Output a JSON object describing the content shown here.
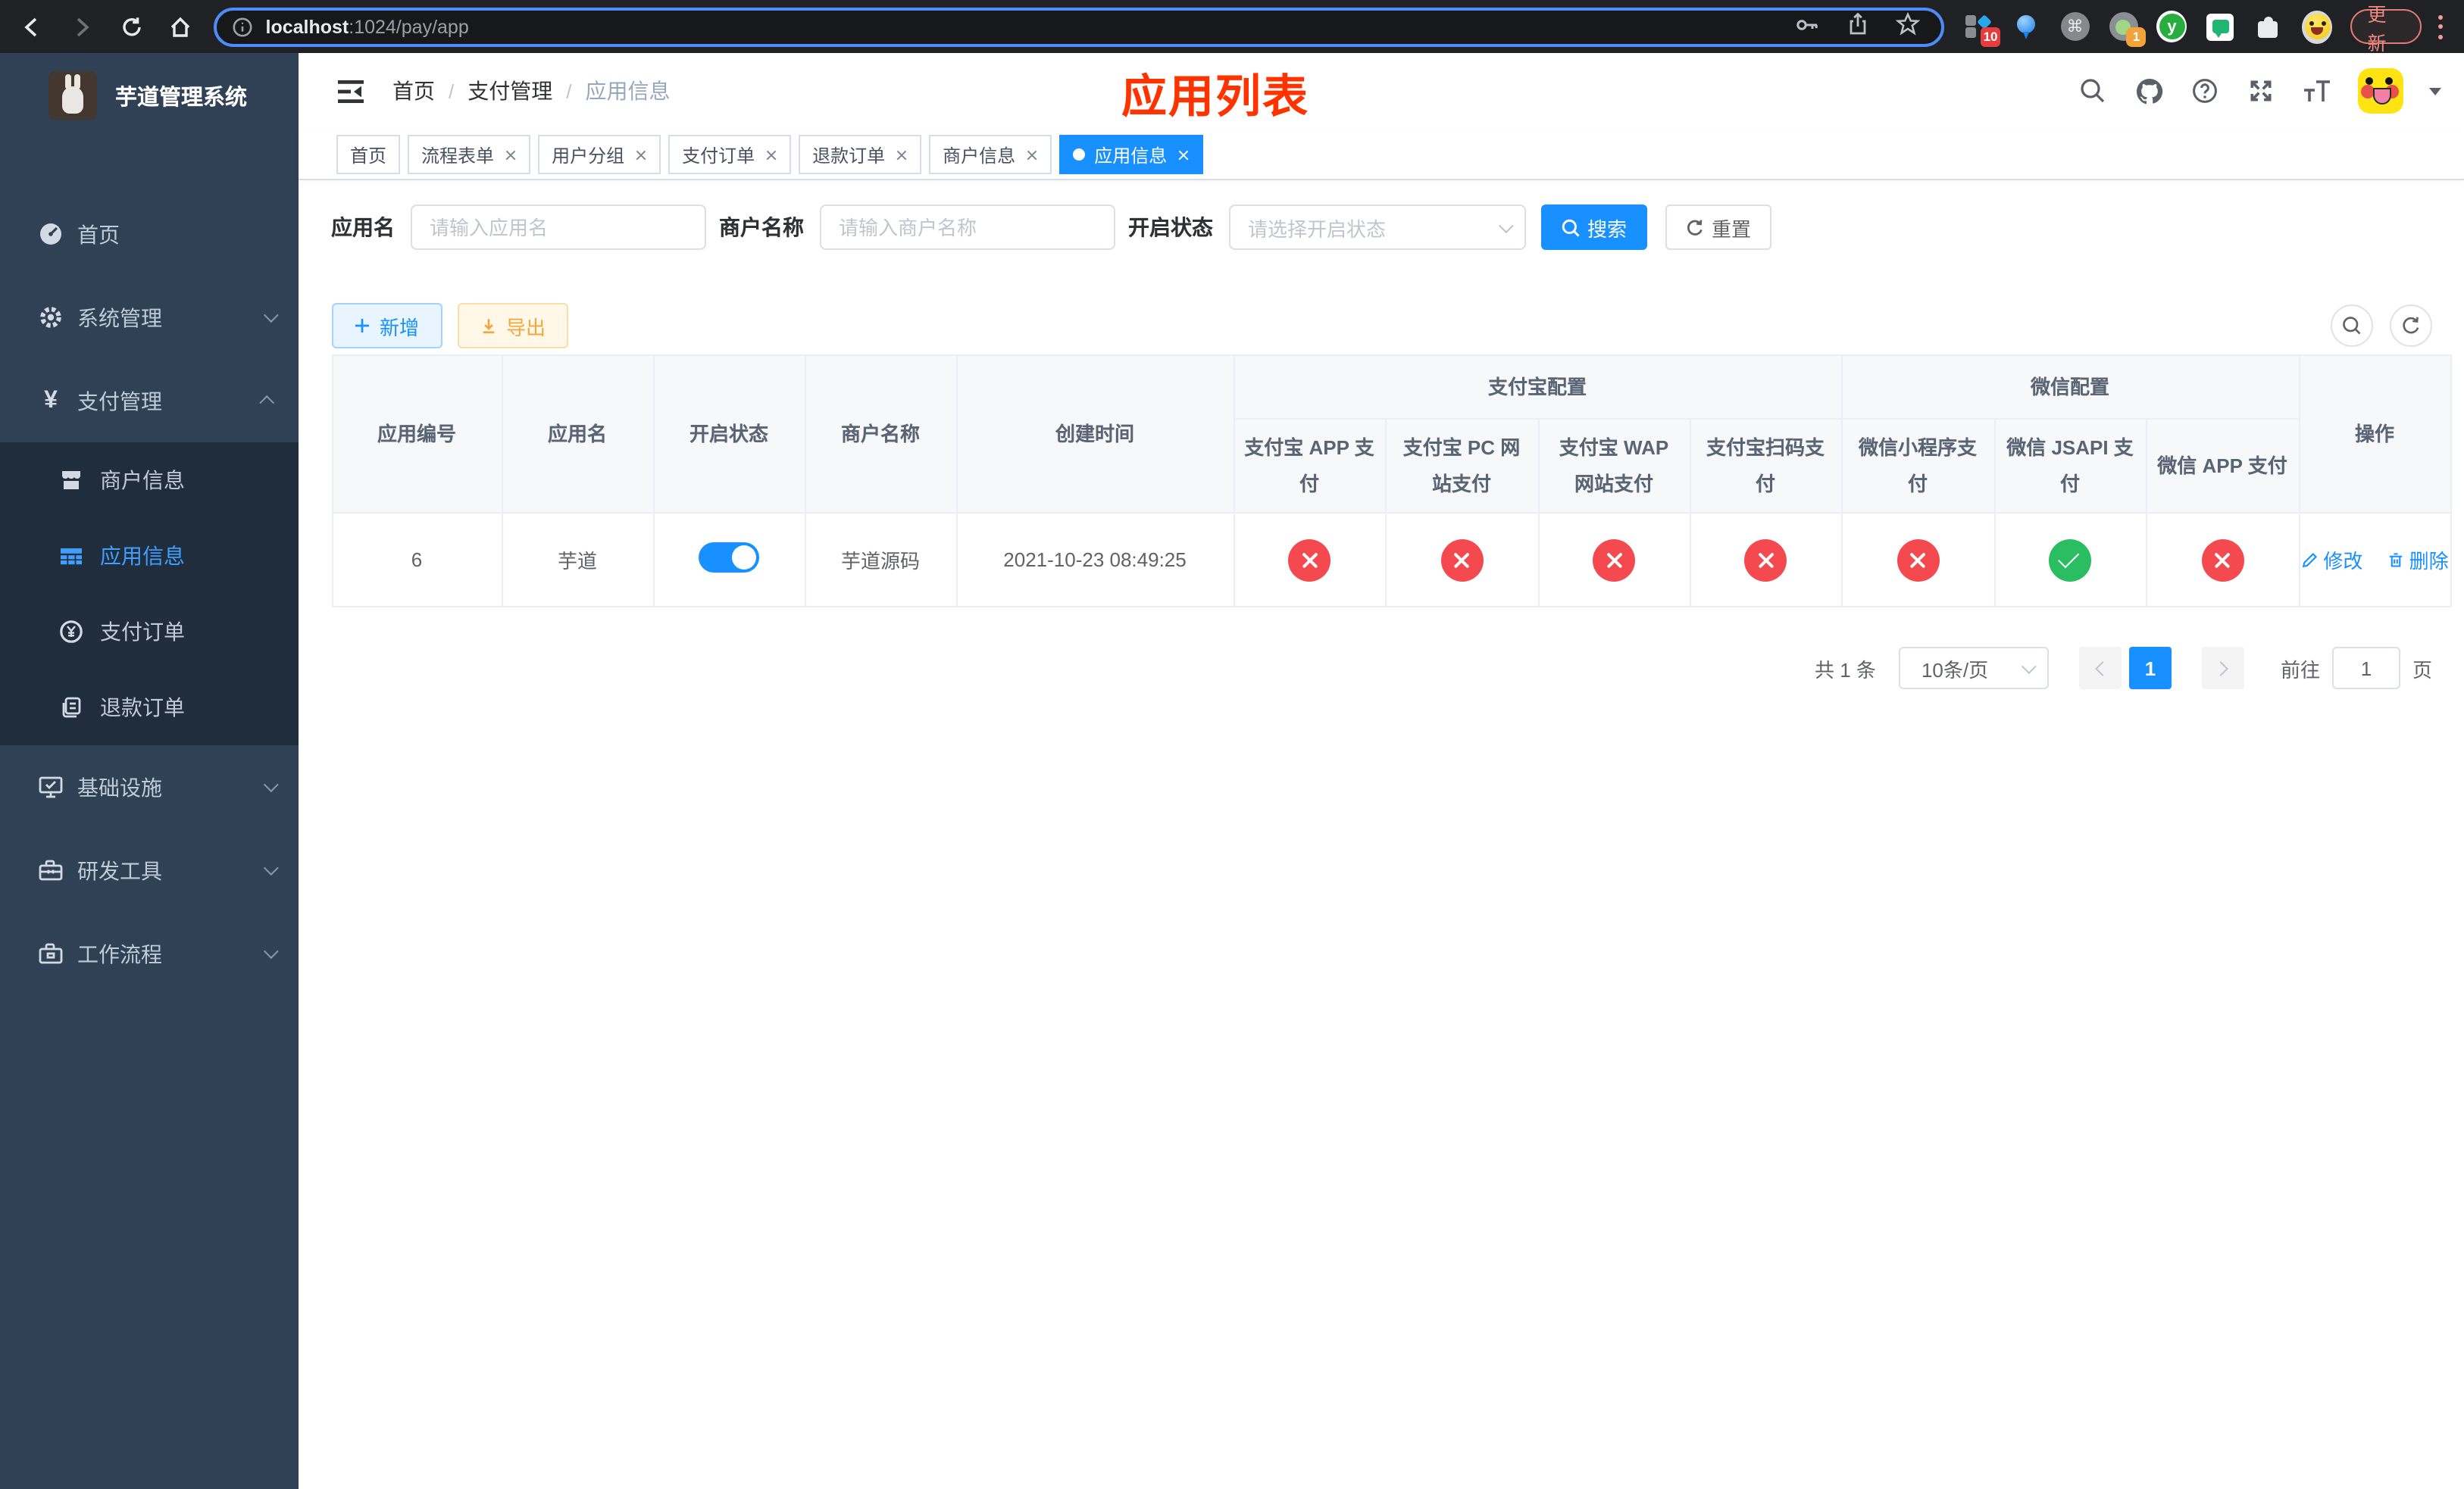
{
  "colors": {
    "accent_blue": "#1890ff",
    "menu_active_blue": "#409eff",
    "sidebar_bg": "#304156",
    "submenu_bg": "#1f2d3d",
    "status_red": "#f4494e",
    "status_green": "#2abd62",
    "annotation_red": "#ff3300",
    "export_orange": "#f3a73f",
    "update_red": "#f28b82"
  },
  "browser": {
    "url": {
      "host": "localhost",
      "path": ":1024/pay/app"
    },
    "update_label": "更新",
    "ext_badges": {
      "first": "10",
      "second": "1"
    }
  },
  "sidebar": {
    "title": "芋道管理系统",
    "menu": [
      {
        "label": "首页"
      },
      {
        "label": "系统管理"
      },
      {
        "label": "支付管理"
      },
      {
        "label": "基础设施"
      },
      {
        "label": "研发工具"
      },
      {
        "label": "工作流程"
      }
    ],
    "submenu": [
      {
        "label": "商户信息"
      },
      {
        "label": "应用信息"
      },
      {
        "label": "支付订单"
      },
      {
        "label": "退款订单"
      }
    ]
  },
  "navbar": {
    "breadcrumb": [
      {
        "label": "首页"
      },
      {
        "label": "支付管理"
      },
      {
        "label": "应用信息"
      }
    ],
    "separator": "/",
    "annotation": "应用列表"
  },
  "tabs": [
    {
      "label": "首页"
    },
    {
      "label": "流程表单"
    },
    {
      "label": "用户分组"
    },
    {
      "label": "支付订单"
    },
    {
      "label": "退款订单"
    },
    {
      "label": "商户信息"
    },
    {
      "label": "应用信息"
    }
  ],
  "filters": {
    "app_name": {
      "label": "应用名",
      "placeholder": "请输入应用名"
    },
    "merchant_name": {
      "label": "商户名称",
      "placeholder": "请输入商户名称"
    },
    "status": {
      "label": "开启状态",
      "placeholder": "请选择开启状态"
    },
    "search_label": "搜索",
    "reset_label": "重置"
  },
  "toolbar": {
    "add_label": "新增",
    "export_label": "导出"
  },
  "table": {
    "columns": [
      "应用编号",
      "应用名",
      "开启状态",
      "商户名称",
      "创建时间",
      "操作"
    ],
    "group_headers": [
      {
        "label": "支付宝配置"
      },
      {
        "label": "微信配置"
      }
    ],
    "sub_columns": [
      "支付宝 APP 支付",
      "支付宝 PC 网站支付",
      "支付宝 WAP 网站支付",
      "支付宝扫码支付",
      "微信小程序支付",
      "微信 JSAPI 支付",
      "微信 APP 支付"
    ],
    "rows": [
      {
        "app_id": "6",
        "app_name": "芋道",
        "enabled": true,
        "merchant_name": "芋道源码",
        "create_time": "2021-10-23 08:49:25",
        "configs": [
          false,
          false,
          false,
          false,
          false,
          true,
          false
        ]
      }
    ],
    "row_actions": {
      "edit": "修改",
      "delete": "删除"
    }
  },
  "pagination": {
    "total": "共 1 条",
    "page_size": "10条/页",
    "page": "1",
    "goto_label": "前往",
    "goto_value": "1",
    "unit_label": "页"
  }
}
